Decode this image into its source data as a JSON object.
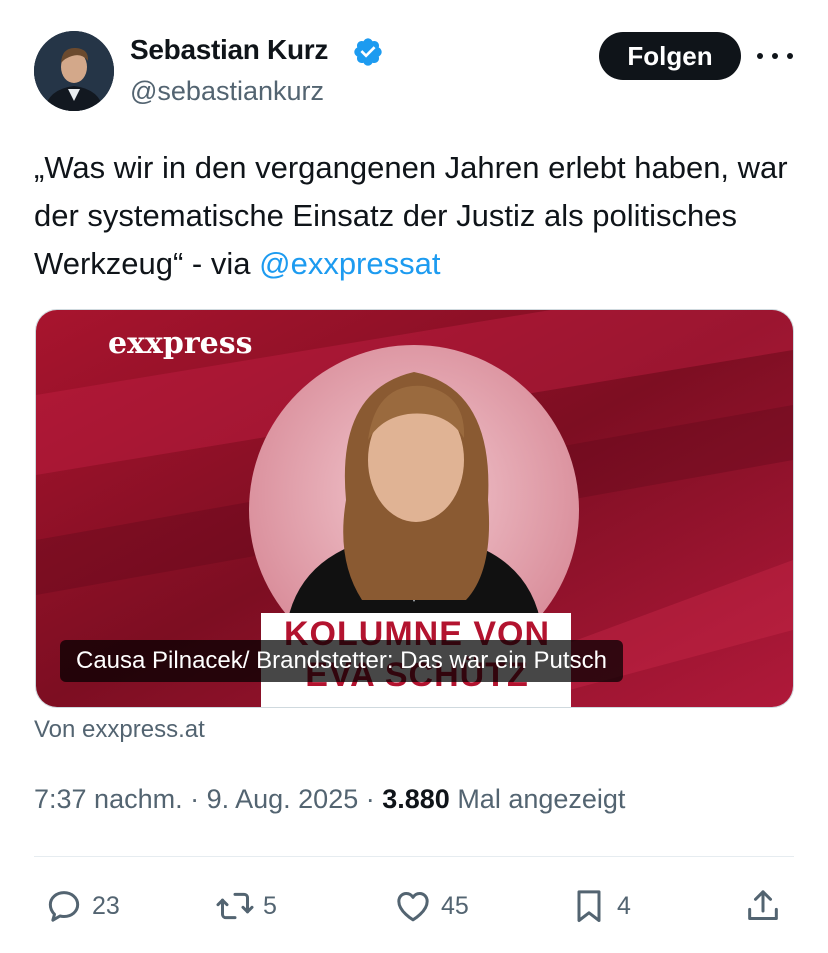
{
  "author": {
    "name": "Sebastian Kurz",
    "handle": "@sebastiankurz",
    "verified": true
  },
  "follow_label": "Folgen",
  "tweet": {
    "text": "„Was wir in den vergangenen Jahren erlebt haben, war der systematische Einsatz der Justiz als politisches Werkzeug“ - via ",
    "mention": "@exxpressat"
  },
  "card": {
    "logo_text": "exxpress",
    "banner_line1": "KOLUMNE VON",
    "banner_line2": "EVA SCHÜTZ",
    "caption": "Causa Pilnacek/ Brandstetter: Das war ein Putsch",
    "source": "Von exxpress.at"
  },
  "meta": {
    "time": "7:37 nachm.",
    "sep": " · ",
    "date": "9. Aug. 2025",
    "views_count": "3.880",
    "views_label": " Mal angezeigt"
  },
  "actions": {
    "replies": "23",
    "reposts": "5",
    "likes": "45",
    "bookmarks": "4"
  },
  "colors": {
    "accent": "#1d9bf0",
    "text_primary": "#0f1419",
    "text_secondary": "#536471",
    "card_red": "#8c1028"
  },
  "icons": [
    "verified-badge-icon",
    "more-icon",
    "reply-icon",
    "repost-icon",
    "like-icon",
    "bookmark-icon",
    "share-icon"
  ]
}
